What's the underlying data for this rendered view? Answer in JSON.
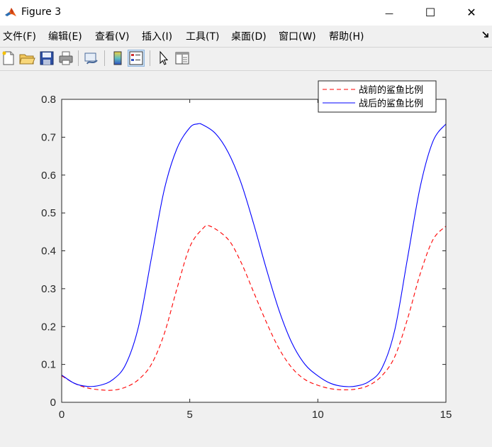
{
  "window": {
    "title": "Figure 3",
    "minimize_glyph": "—",
    "maximize_glyph": "☐",
    "close_glyph": "✕",
    "app_icon": "matlab-icon"
  },
  "menu": {
    "items": [
      {
        "label": "文件(F)",
        "key": "file"
      },
      {
        "label": "编辑(E)",
        "key": "edit"
      },
      {
        "label": "查看(V)",
        "key": "view"
      },
      {
        "label": "插入(I)",
        "key": "insert"
      },
      {
        "label": "工具(T)",
        "key": "tools"
      },
      {
        "label": "桌面(D)",
        "key": "desktop"
      },
      {
        "label": "窗口(W)",
        "key": "window"
      },
      {
        "label": "帮助(H)",
        "key": "help"
      }
    ],
    "overflow_icon": "dock-arrow-icon"
  },
  "toolbar": {
    "buttons": [
      {
        "icon": "new-figure-icon"
      },
      {
        "icon": "open-file-icon"
      },
      {
        "icon": "save-icon"
      },
      {
        "icon": "print-icon"
      },
      {
        "icon": "link-plot-icon"
      },
      {
        "icon": "colorbar-icon"
      },
      {
        "icon": "legend-icon",
        "active": true
      },
      {
        "icon": "pointer-icon"
      },
      {
        "icon": "property-editor-icon"
      }
    ]
  },
  "chart_data": {
    "type": "line",
    "xlim": [
      0,
      15
    ],
    "ylim": [
      0,
      0.8
    ],
    "xticks": [
      0,
      5,
      10,
      15
    ],
    "yticks": [
      0,
      0.1,
      0.2,
      0.3,
      0.4,
      0.5,
      0.6,
      0.7,
      0.8
    ],
    "xtick_labels": [
      "0",
      "5",
      "10",
      "15"
    ],
    "ytick_labels": [
      "0",
      "0.1",
      "0.2",
      "0.3",
      "0.4",
      "0.5",
      "0.6",
      "0.7",
      "0.8"
    ],
    "legend_position": "top-right",
    "grid": false,
    "series": [
      {
        "name": "战前的鲨鱼比例",
        "color": "#ff0000",
        "style": "dashed",
        "x": [
          0,
          0.5,
          1,
          1.5,
          2,
          2.5,
          3,
          3.5,
          4,
          4.5,
          5,
          5.5,
          5.8,
          6.5,
          7,
          7.5,
          8,
          8.5,
          9,
          9.5,
          10,
          10.5,
          11,
          11.5,
          12,
          12.5,
          13,
          13.5,
          14,
          14.5,
          15
        ],
        "y": [
          0.07,
          0.05,
          0.038,
          0.033,
          0.032,
          0.04,
          0.06,
          0.1,
          0.18,
          0.3,
          0.41,
          0.458,
          0.465,
          0.43,
          0.37,
          0.29,
          0.21,
          0.14,
          0.09,
          0.06,
          0.045,
          0.036,
          0.033,
          0.035,
          0.045,
          0.07,
          0.12,
          0.22,
          0.34,
          0.43,
          0.465
        ]
      },
      {
        "name": "战后的鲨鱼比例",
        "color": "#0000ff",
        "style": "solid",
        "x": [
          0,
          0.5,
          1,
          1.5,
          2,
          2.5,
          3,
          3.5,
          4,
          4.5,
          5,
          5.3,
          5.5,
          6,
          6.5,
          7,
          7.5,
          8,
          8.5,
          9,
          9.5,
          10,
          10.5,
          11,
          11.5,
          12,
          12.5,
          13,
          13.5,
          14,
          14.5,
          15
        ],
        "y": [
          0.072,
          0.05,
          0.042,
          0.045,
          0.06,
          0.1,
          0.2,
          0.38,
          0.56,
          0.67,
          0.725,
          0.735,
          0.733,
          0.71,
          0.66,
          0.58,
          0.47,
          0.35,
          0.24,
          0.155,
          0.1,
          0.07,
          0.05,
          0.042,
          0.043,
          0.055,
          0.09,
          0.19,
          0.38,
          0.57,
          0.69,
          0.735
        ]
      }
    ]
  }
}
